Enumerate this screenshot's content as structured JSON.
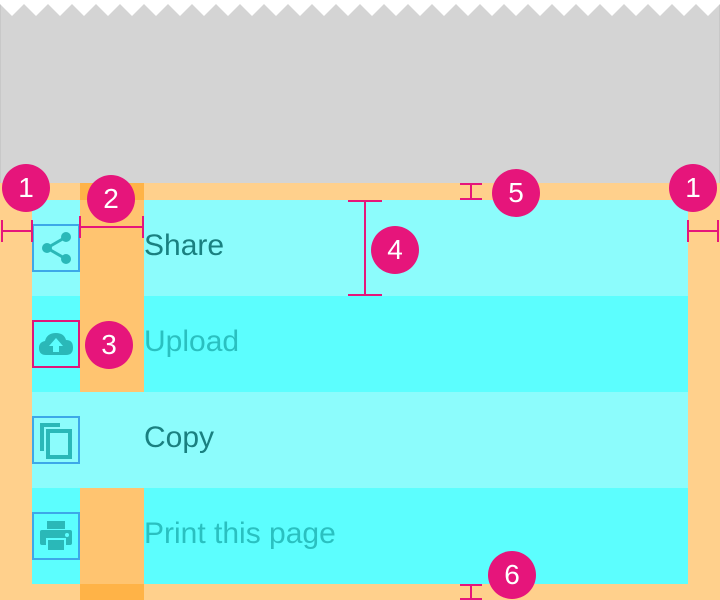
{
  "menu": {
    "items": [
      {
        "label": "Share",
        "icon": "share-icon",
        "style": "dark"
      },
      {
        "label": "Upload",
        "icon": "cloud-upload-icon",
        "style": "teal"
      },
      {
        "label": "Copy",
        "icon": "copy-icon",
        "style": "dark"
      },
      {
        "label": "Print this page",
        "icon": "print-icon",
        "style": "teal"
      }
    ]
  },
  "annotations": {
    "badge_1_left": "1",
    "badge_2": "2",
    "badge_3": "3",
    "badge_4": "4",
    "badge_5": "5",
    "badge_1_right": "1",
    "badge_6": "6"
  },
  "colors": {
    "annotation": "#e6157b",
    "margin_fill": "#ffd08c",
    "row_light": "#8cfcfc",
    "row_bright": "#5cfefe",
    "icon_teal": "#2ab8b8",
    "text_dark": "#1a8080",
    "text_teal": "#2ac0c0",
    "background_gray": "#d4d4d4"
  }
}
